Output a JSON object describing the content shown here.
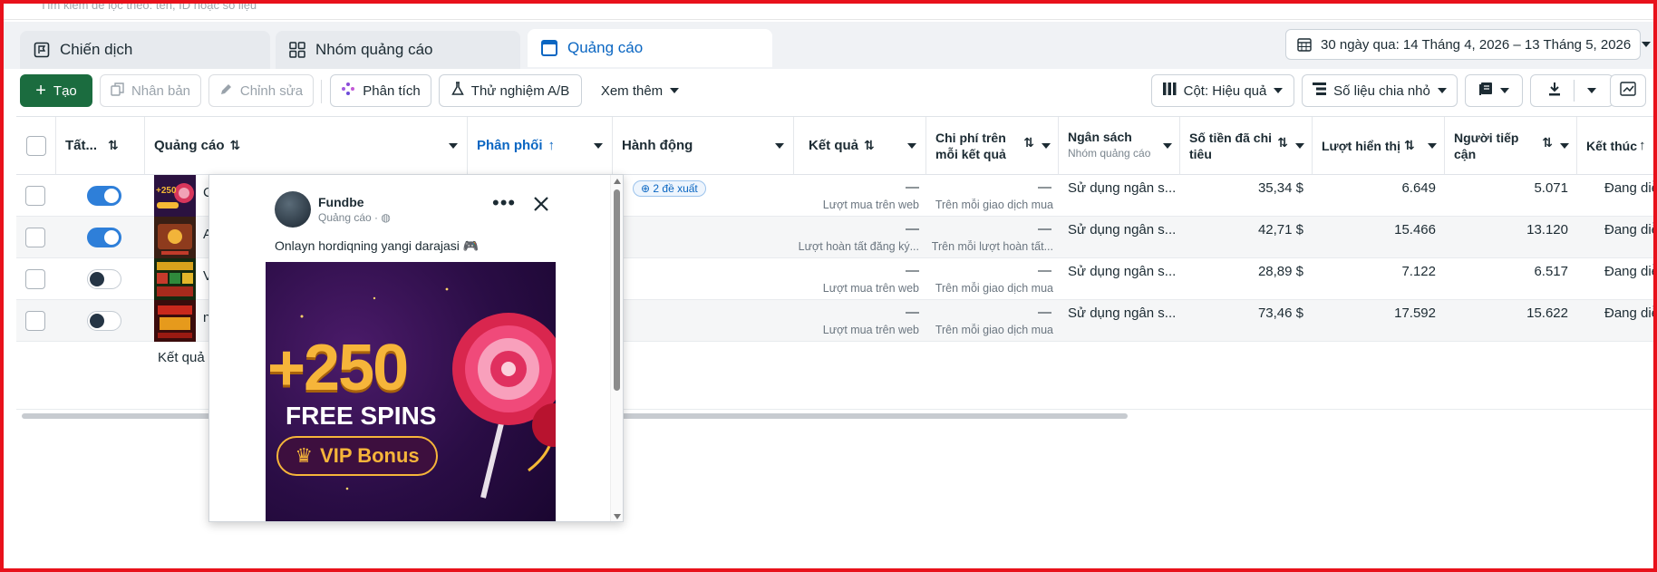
{
  "search": {
    "placeholder": "Tìm kiếm để lọc theo: tên, ID hoặc số liệu"
  },
  "tabs": [
    {
      "label": "Chiến dịch"
    },
    {
      "label": "Nhóm quảng cáo"
    },
    {
      "label": "Quảng cáo"
    }
  ],
  "date_range": {
    "label": "30 ngày qua: 14 Tháng 4, 2026 – 13 Tháng 5, 2026"
  },
  "toolbar": {
    "create": "Tạo",
    "duplicate": "Nhân bản",
    "edit": "Chỉnh sửa",
    "analyze": "Phân tích",
    "ab_test": "Thử nghiệm A/B",
    "more": "Xem thêm",
    "columns": "Cột: Hiệu quả",
    "breakdown": "Số liệu chia nhỏ"
  },
  "headers": {
    "all": "Tất...",
    "ad": "Quảng cáo",
    "delivery": "Phân phối",
    "actions": "Hành động",
    "results": "Kết quả",
    "cost_per_result_1": "Chi phí trên",
    "cost_per_result_2": "mỗi kết quả",
    "budget": "Ngân sách",
    "budget_sub": "Nhóm quảng cáo",
    "spent_1": "Số tiền đã chi",
    "spent_2": "tiêu",
    "impressions": "Lượt hiển thị",
    "reach_1": "Người tiếp",
    "reach_2": "cận",
    "ends": "Kết thúc"
  },
  "rows": [
    {
      "name": "C",
      "on": true,
      "badge": "2 đề xuất",
      "result": "—",
      "result_sub": "Lượt mua trên web",
      "cost": "—",
      "cost_sub": "Trên mỗi giao dịch mua",
      "budget": "Sử dụng ngân s...",
      "spent": "35,34 $",
      "impressions": "6.649",
      "reach": "5.071",
      "ends": "Đang diễ"
    },
    {
      "name": "A",
      "on": true,
      "badge": "",
      "result": "—",
      "result_sub": "Lượt hoàn tất đăng ký...",
      "cost": "—",
      "cost_sub": "Trên mỗi lượt hoàn tất...",
      "budget": "Sử dụng ngân s...",
      "spent": "42,71 $",
      "impressions": "15.466",
      "reach": "13.120",
      "ends": "Đang diễ"
    },
    {
      "name": "V",
      "on": false,
      "badge": "",
      "result": "—",
      "result_sub": "Lượt mua trên web",
      "cost": "—",
      "cost_sub": "Trên mỗi giao dịch mua",
      "budget": "Sử dụng ngân s...",
      "spent": "28,89 $",
      "impressions": "7.122",
      "reach": "6.517",
      "ends": "Đang diễ"
    },
    {
      "name": "n",
      "on": false,
      "badge": "",
      "result": "—",
      "result_sub": "Lượt mua trên web",
      "cost": "—",
      "cost_sub": "Trên mỗi giao dịch mua",
      "budget": "Sử dụng ngân s...",
      "spent": "73,46 $",
      "impressions": "17.592",
      "reach": "15.622",
      "ends": "Đang diễ"
    }
  ],
  "results_label": "Kết quả t",
  "popup": {
    "page_name": "Fundbe",
    "page_sub": "Quảng cáo ·",
    "caption": "Onlayn hordiqning yangi darajasi 🎮",
    "creative": {
      "headline": "+250",
      "sub": "FREE SPINS",
      "cta": "VIP Bonus"
    }
  },
  "colors": {
    "accent": "#0a66c2",
    "primary_button": "#1b6c3f",
    "frame_border": "#e8111b",
    "toggle_on": "#2e7fd9"
  }
}
